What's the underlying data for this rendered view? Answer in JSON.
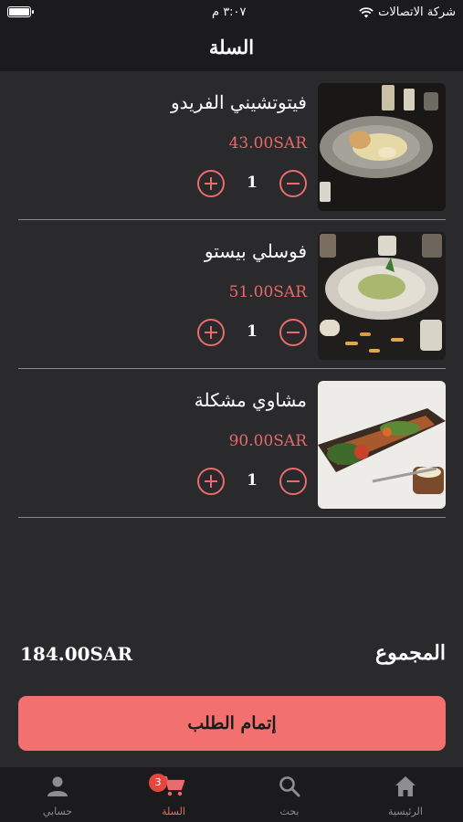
{
  "status_bar": {
    "carrier": "شركة الاتصالات",
    "time": "٣:٠٧ م"
  },
  "header": {
    "title": "السلة"
  },
  "cart": {
    "items": [
      {
        "name": "فيتوتشيني الفريدو",
        "price": "43.00SAR",
        "quantity": "1",
        "image": "fettuccine-alfredo"
      },
      {
        "name": "فوسلي بيستو",
        "price": "51.00SAR",
        "quantity": "1",
        "image": "fusilli-pesto"
      },
      {
        "name": "مشاوي مشكلة",
        "price": "90.00SAR",
        "quantity": "1",
        "image": "mixed-grill"
      }
    ]
  },
  "summary": {
    "total_label": "المجموع",
    "total_amount": "184.00SAR"
  },
  "checkout": {
    "label": "إتمام الطلب"
  },
  "tabbar": {
    "tabs": [
      {
        "label": "الرئيسية",
        "icon": "home-icon"
      },
      {
        "label": "بحث",
        "icon": "search-icon"
      },
      {
        "label": "السلة",
        "icon": "cart-icon",
        "badge": "3",
        "active": true
      },
      {
        "label": "حسابي",
        "icon": "person-icon"
      }
    ]
  },
  "colors": {
    "accent": "#f2706e",
    "price": "#e56a6a",
    "background": "#2a2a2c",
    "bars": "#1b1b1d",
    "badge": "#e5473f"
  }
}
